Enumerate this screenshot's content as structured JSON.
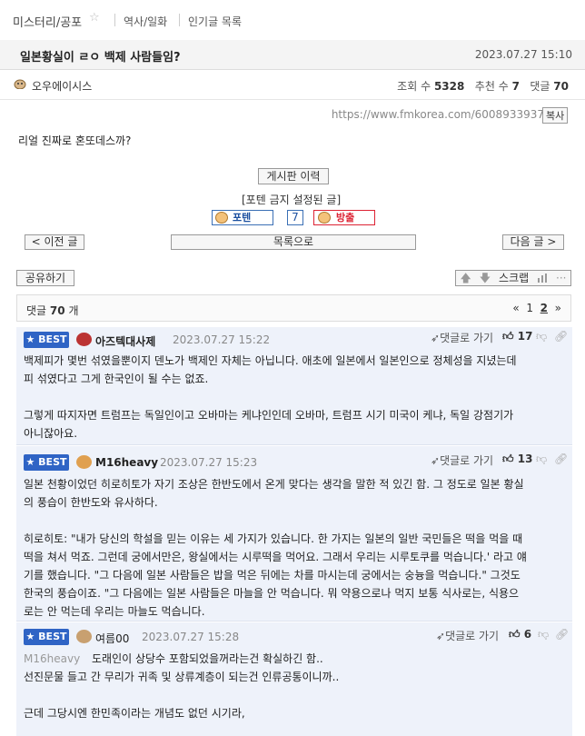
{
  "topbar": {
    "category": "미스터리/공포",
    "star": "☆",
    "links": [
      "역사/일화",
      "인기글 목록"
    ]
  },
  "post": {
    "title": "일본황실이 ㄹㅇ 백제 사람들임?",
    "date": "2023.07.27 15:10",
    "author": "오우에이시스",
    "views_label": "조회 수",
    "views": "5328",
    "recommend_label": "추천 수",
    "recommend": "7",
    "comments_label": "댓글",
    "comments": "70",
    "url": "https://www.fmkorea.com/6008933937",
    "copy_label": "복사",
    "content": "리얼 진짜로 혼또데스까?"
  },
  "actions": {
    "history": "게시판 이력",
    "banned": "[포텐 금지 설정된 글]",
    "poten": "포텐",
    "poten_count": "7",
    "bang": "방출",
    "prev": "< 이전 글",
    "list": "목록으로",
    "next": "다음 글 >",
    "share": "공유하기",
    "up_icon": "🡅",
    "down_icon": "🡇",
    "scrap": "스크랩"
  },
  "comment_bar": {
    "label": "댓글",
    "count": "70",
    "unit": "개",
    "pages": [
      "1",
      "2"
    ]
  },
  "comments": [
    {
      "badge": "★ BEST",
      "author": "아즈텍대사제",
      "date": "2023.07.27 15:22",
      "reply": "댓글로 가기",
      "likes": "17",
      "text": "백제피가 몇번 섞였을뿐이지 덴노가 백제인 자체는 아닙니다. 애초에 일본에서 일본인으로 정체성을 지녔는데\n피 섞였다고 그게 한국인이 될 수는 없죠.\n\n그렇게 따지자면 트럼프는 독일인이고 오바마는 케냐인인데 오바마, 트럼프 시기 미국이 케냐, 독일 강점기가\n아니잖아요."
    },
    {
      "badge": "★ BEST",
      "author": "M16heavy",
      "date": "2023.07.27 15:23",
      "reply": "댓글로 가기",
      "likes": "13",
      "text": "일본 천황이었던 히로히토가 자기 조상은 한반도에서 온게 맞다는 생각을 말한 적 있긴 함. 그 정도로 일본 황실\n의 풍습이 한반도와 유사하다.\n\n히로히토: \"내가 당신의 학설을 믿는 이유는 세 가지가 있습니다. 한 가지는 일본의 일반 국민들은 떡을 먹을 때\n떡을 쳐서 먹죠. 그런데 궁에서만은, 왕실에서는 시루떡을 먹어요. 그래서 우리는 시루토쿠를 먹습니다.' 라고 얘\n기를 했습니다. \"그 다음에 일본 사람들은 밥을 먹은 뒤에는 차를 마시는데 궁에서는 숭늉을 먹습니다.\" 그것도\n한국의 풍습이죠. \"그 다음에는 일본 사람들은 마늘을 안 먹습니다. 뭐 약용으로나 먹지 보통 식사로는, 식용으\n로는 안 먹는데 우리는 마늘도 먹습니다."
    },
    {
      "badge": "★ BEST",
      "author": "여름00",
      "date": "2023.07.27 15:28",
      "reply": "댓글로 가기",
      "likes": "6",
      "mention": "M16heavy",
      "text": "도래인이 상당수 포함되었을꺼라는건 확실하긴 함..\n선진문물 들고 간 무리가 귀족 및 상류계층이 되는건 인류공통이니까..\n\n근데 그당시엔 한민족이라는 개념도 없던 시기라,"
    }
  ]
}
